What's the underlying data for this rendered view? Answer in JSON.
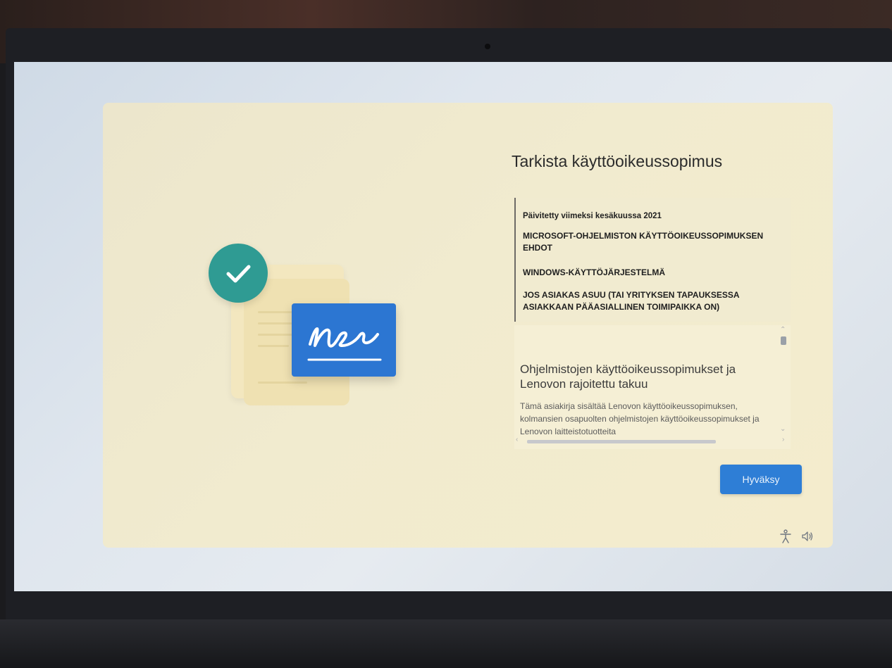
{
  "oobe": {
    "title": "Tarkista käyttöoikeussopimus",
    "ms_terms": [
      "Päivitetty viimeksi kesäkuussa 2021",
      "MICROSOFT-OHJELMISTON KÄYTTÖOIKEUSSOPIMUKSEN EHDOT",
      "WINDOWS-KÄYTTÖJÄRJESTELMÄ",
      "JOS ASIAKAS ASUU (TAI YRITYKSEN TAPAUKSESSA ASIAKKAAN PÄÄASIALLINEN TOIMIPAIKKA ON)"
    ],
    "oem_terms": {
      "title": "Ohjelmistojen käyttöoikeussopimukset ja Lenovon rajoitettu takuu",
      "body": "Tämä asiakirja sisältää Lenovon käyttöoikeussopimuksen, kolmansien osapuolten ohjelmistojen käyttöoikeussopimukset ja Lenovon laitteistotuotteita"
    },
    "accept_label": "Hyväksy"
  },
  "tray": {
    "accessibility_icon": "accessibility-icon",
    "volume_icon": "volume-icon"
  },
  "colors": {
    "accent": "#2e7ed6",
    "check": "#2f9b93",
    "card": "#f1ebcf"
  }
}
